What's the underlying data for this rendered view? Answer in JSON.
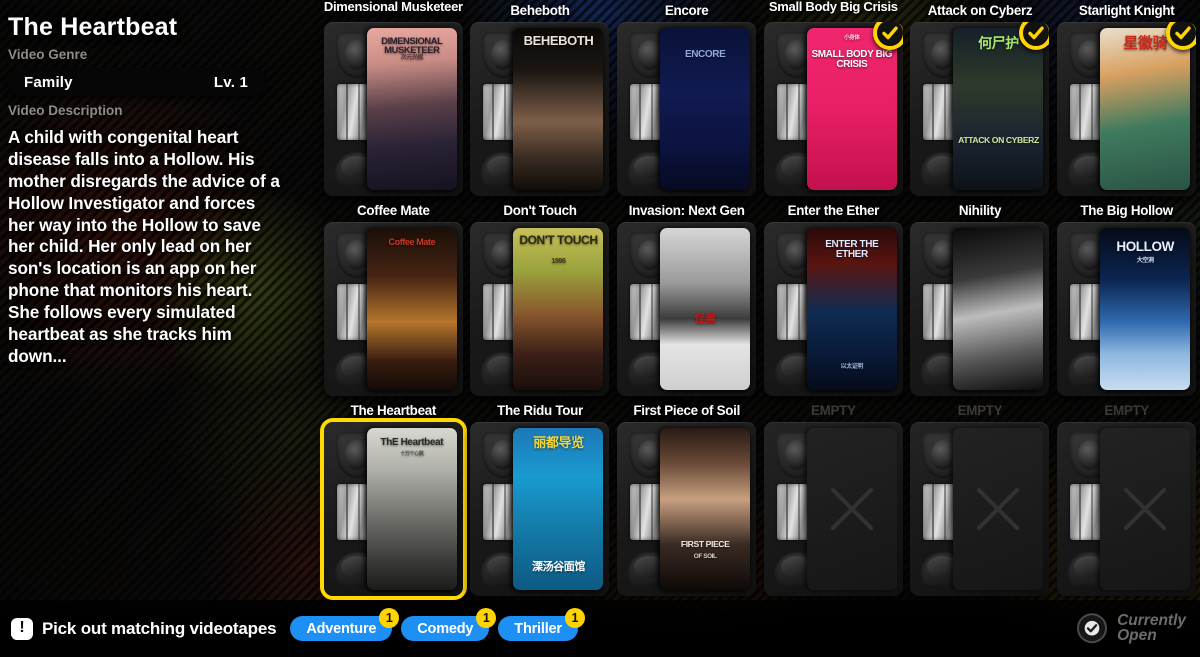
{
  "info_panel": {
    "video_title": "The Heartbeat",
    "genre_label": "Video Genre",
    "genre_name": "Family",
    "genre_level": "Lv. 1",
    "description_label": "Video Description",
    "description": "A child with congenital heart disease falls into a Hollow. His mother disregards the advice of a Hollow Investigator and forces her way into the Hollow to save her child. Her only lead on her son's location is an app on her phone that monitors his heart. She follows every simulated heartbeat as she tracks him down..."
  },
  "grid": {
    "columns": 6,
    "rows": 3,
    "tapes": [
      {
        "title": "Dimensional Musketeer",
        "state": "normal",
        "poster_text": "DIMENSIONAL MUSKETEER",
        "poster_sub": "次元光棍"
      },
      {
        "title": "Beheboth",
        "state": "normal",
        "poster_text": "BEHEBOTH",
        "poster_sub": ""
      },
      {
        "title": "Encore",
        "state": "normal",
        "poster_text": "ENCORE",
        "poster_sub": ""
      },
      {
        "title": "Small Body Big Crisis",
        "state": "checked",
        "poster_text": "SMALL BODY BIG CRISIS",
        "poster_sub": "小身体"
      },
      {
        "title": "Attack on Cyberz",
        "state": "checked",
        "poster_text": "ATTACK ON CYBERZ",
        "poster_sub": "何尸护"
      },
      {
        "title": "Starlight Knight",
        "state": "checked",
        "poster_text": "",
        "poster_sub": "星徽骑"
      },
      {
        "title": "Coffee Mate",
        "state": "normal",
        "poster_text": "Coffee Mate",
        "poster_sub": ""
      },
      {
        "title": "Don't Touch",
        "state": "normal",
        "poster_text": "DON'T TOUCH",
        "poster_sub": "1996"
      },
      {
        "title": "Invasion: Next Gen",
        "state": "normal",
        "poster_text": "",
        "poster_sub": "怪兽"
      },
      {
        "title": "Enter the Ether",
        "state": "normal",
        "poster_text": "ENTER THE ETHER",
        "poster_sub": "以太证明"
      },
      {
        "title": "Nihility",
        "state": "normal",
        "poster_text": "",
        "poster_sub": ""
      },
      {
        "title": "The Big Hollow",
        "state": "normal",
        "poster_text": "HOLLOW",
        "poster_sub": "大空洞"
      },
      {
        "title": "The Heartbeat",
        "state": "selected",
        "poster_text": "ThE Heartbeat",
        "poster_sub": "十万个心跳"
      },
      {
        "title": "The Ridu Tour",
        "state": "normal",
        "poster_text": "丽都导览",
        "poster_sub": "溧汤谷面馆"
      },
      {
        "title": "First Piece of Soil",
        "state": "normal",
        "poster_text": "FIRST PIECE",
        "poster_sub": "OF SOIL"
      },
      {
        "title": "EMPTY",
        "state": "empty",
        "poster_text": "",
        "poster_sub": ""
      },
      {
        "title": "EMPTY",
        "state": "empty",
        "poster_text": "",
        "poster_sub": ""
      },
      {
        "title": "EMPTY",
        "state": "empty",
        "poster_text": "",
        "poster_sub": ""
      }
    ]
  },
  "bottom_bar": {
    "objective_icon": "exclamation-icon",
    "objective_text": "Pick out matching videotapes",
    "genre_tags": [
      {
        "label": "Adventure",
        "count": "1"
      },
      {
        "label": "Comedy",
        "count": "1"
      },
      {
        "label": "Thriller",
        "count": "1"
      }
    ],
    "status_icon": "check-circle-icon",
    "status_line1": "Currently",
    "status_line2": "Open"
  },
  "colors": {
    "accent_yellow": "#ffd400",
    "tag_blue": "#1e90f5",
    "selected_border": "#ffd900",
    "status_gray": "#6d6d6d"
  }
}
